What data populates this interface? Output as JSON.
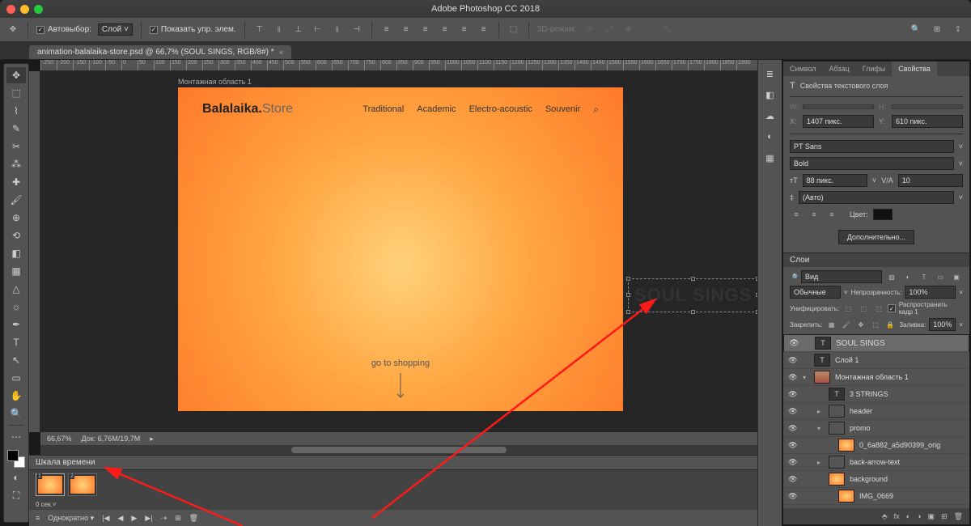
{
  "titlebar": {
    "title": "Adobe Photoshop CC 2018"
  },
  "options": {
    "autoselect_label": "Автовыбор:",
    "autoselect_value": "Слой",
    "show_controls_label": "Показать упр. элем.",
    "mode3d": "3D-режим:"
  },
  "doc": {
    "tab": "animation-balalaika-store.psd @ 66,7% (SOUL SINGS, RGB/8#) *",
    "artboard_label": "Монтажная область 1",
    "zoom": "66,67%",
    "docinfo": "Док: 6,76M/19,7M"
  },
  "site": {
    "logo_a": "Balalaika.",
    "logo_b": "Store",
    "nav": [
      "Traditional",
      "Academic",
      "Electro-acoustic",
      "Souvenir"
    ],
    "cta": "go to shopping"
  },
  "text_layer": {
    "content": "SOUL SINGS"
  },
  "ruler_ticks": [
    "-250",
    "-200",
    "-150",
    "-100",
    "-50",
    "0",
    "50",
    "100",
    "150",
    "200",
    "250",
    "300",
    "350",
    "400",
    "450",
    "500",
    "550",
    "600",
    "650",
    "700",
    "750",
    "800",
    "850",
    "900",
    "950",
    "1000",
    "1050",
    "1100",
    "1150",
    "1200",
    "1250",
    "1300",
    "1350",
    "1400",
    "1450",
    "1500",
    "1550",
    "1600",
    "1650",
    "1700",
    "1750",
    "1800",
    "1850",
    "1900"
  ],
  "timeline": {
    "title": "Шкала времени",
    "frames": [
      "1",
      "2"
    ],
    "delay": "0 сек.",
    "loop": "Однократно"
  },
  "panels": {
    "tabs": [
      "Символ",
      "Абзац",
      "Глифы",
      "Свойства"
    ],
    "active_tab": 3,
    "props_title": "Свойства текстового слоя",
    "x_label": "X:",
    "x_val": "1407 пикс.",
    "y_label": "Y:",
    "y_val": "610 пикс.",
    "font": "PT Sans",
    "weight": "Bold",
    "size": "88 пикс.",
    "tracking": "10",
    "leading": "(Авто)",
    "color_label": "Цвет:",
    "more_btn": "Дополнительно..."
  },
  "layers_panel": {
    "title": "Слои",
    "search": "Вид",
    "blend": "Обычные",
    "opacity_label": "Непрозрачность:",
    "opacity": "100%",
    "unify_label": "Унифицировать:",
    "propagate_label": "Распространить кадр 1",
    "lock_label": "Закрепить:",
    "fill_label": "Заливка:",
    "fill": "100%",
    "layers": [
      {
        "name": "SOUL SINGS",
        "type": "t",
        "sel": true,
        "indent": 0
      },
      {
        "name": "Слой 1",
        "type": "t",
        "indent": 0
      },
      {
        "name": "Монтажная область 1",
        "type": "ab",
        "indent": 0,
        "open": true
      },
      {
        "name": "3 STRINGS",
        "type": "t",
        "indent": 1
      },
      {
        "name": "header",
        "type": "fold",
        "indent": 1
      },
      {
        "name": "promo",
        "type": "fold",
        "indent": 1,
        "open": true
      },
      {
        "name": "0_6a882_a5d90399_orig",
        "type": "img",
        "indent": 2
      },
      {
        "name": "back-arrow-text",
        "type": "fold",
        "indent": 1
      },
      {
        "name": "background",
        "type": "img",
        "indent": 1
      },
      {
        "name": "IMG_0669",
        "type": "img",
        "indent": 2
      }
    ]
  }
}
